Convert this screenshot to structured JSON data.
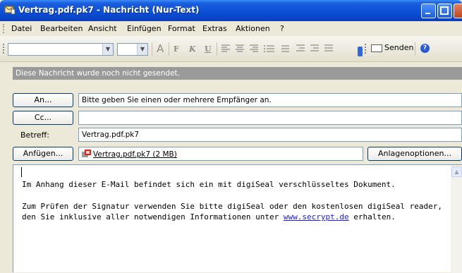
{
  "window": {
    "title": "Vertrag.pdf.pk7 - Nachricht (Nur-Text)",
    "colors": {
      "titlebar": "#0a4fd4",
      "close_button": "#c1441e",
      "link": "#1919ff"
    }
  },
  "menu": [
    "Datei",
    "Bearbeiten",
    "Ansicht",
    "Einfügen",
    "Format",
    "Extras",
    "Aktionen",
    "?"
  ],
  "toolbar": {
    "icons": [
      "font-color-icon",
      "bold-icon",
      "italic-icon",
      "underline-icon",
      "align-left-icon",
      "align-center-icon",
      "align-right-icon",
      "bullets-icon",
      "numbering-icon",
      "decrease-indent-icon",
      "increase-indent-icon",
      "shrink-icon"
    ],
    "bold": "F",
    "italic": "K",
    "underline": "U",
    "font_color": "A",
    "send_label": "Senden"
  },
  "info_bar": "Diese Nachricht wurde noch nicht gesendet.",
  "header": {
    "to_button": "An...",
    "to_value": "Bitte geben Sie einen oder mehrere Empfänger an.",
    "cc_button": "Cc...",
    "cc_value": "",
    "subject_label": "Betreff:",
    "subject_value": "Vertrag.pdf.pk7",
    "attach_button": "Anfügen...",
    "attachment": "Vertrag.pdf.pk7 (2 MB)",
    "attach_options_button": "Anlagenoptionen..."
  },
  "message": {
    "paragraph1": "Im Anhang dieser E-Mail befindet sich ein mit digiSeal verschlüsseltes Dokument.",
    "paragraph2_before": "Zum Prüfen der Signatur verwenden Sie bitte digiSeal oder den kostenlosen digiSeal reader, den Sie inklusive aller notwendigen Informationen unter ",
    "link": "www.secrypt.de",
    "paragraph2_after": " erhalten."
  }
}
